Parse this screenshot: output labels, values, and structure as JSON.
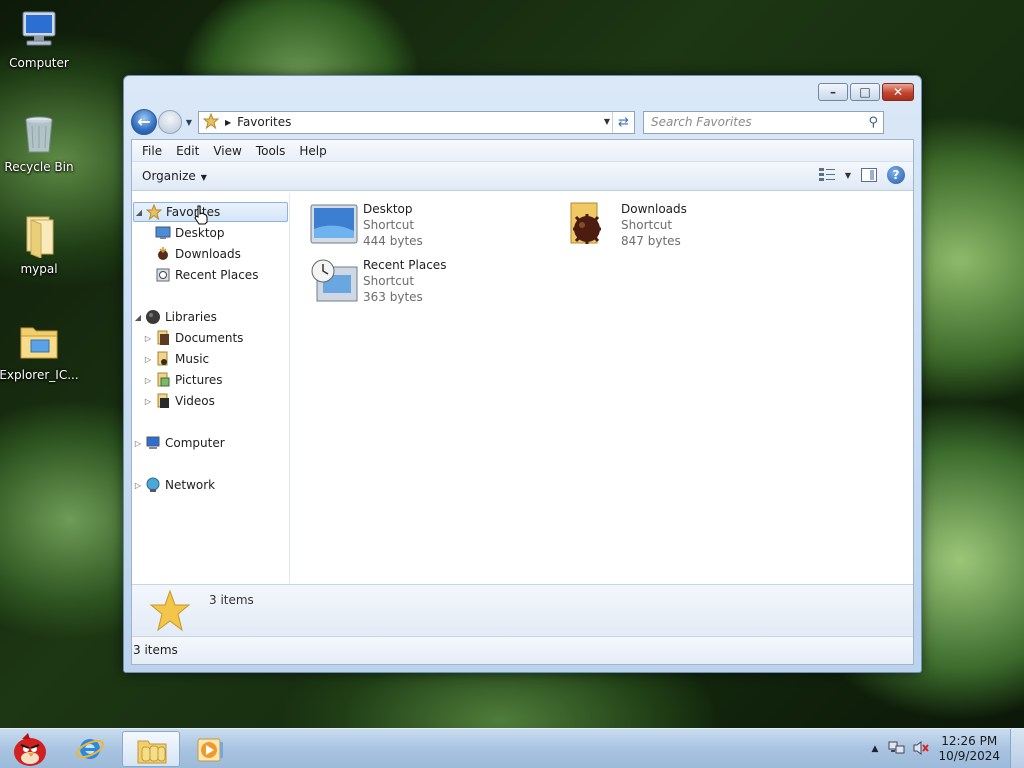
{
  "desktop": {
    "icons": [
      {
        "label": "Computer",
        "icon": "computer-icon"
      },
      {
        "label": "Recycle Bin",
        "icon": "recycle-bin-icon"
      },
      {
        "label": "mypal",
        "icon": "folder-icon"
      },
      {
        "label": "Explorer_IC...",
        "icon": "folder-icon"
      }
    ]
  },
  "window": {
    "address": {
      "crumb": "Favorites"
    },
    "search": {
      "placeholder": "Search Favorites"
    },
    "menu": [
      "File",
      "Edit",
      "View",
      "Tools",
      "Help"
    ],
    "command": {
      "organize": "Organize"
    },
    "nav_tree": [
      {
        "label": "Favorites",
        "icon": "favorites-star-icon",
        "expanded": true,
        "selected": true
      },
      {
        "label": "Desktop",
        "icon": "desktop-icon"
      },
      {
        "label": "Downloads",
        "icon": "downloads-icon"
      },
      {
        "label": "Recent Places",
        "icon": "recent-places-icon"
      },
      {
        "label": "Libraries",
        "icon": "libraries-icon",
        "expanded": true
      },
      {
        "label": "Documents",
        "icon": "documents-icon"
      },
      {
        "label": "Music",
        "icon": "music-icon"
      },
      {
        "label": "Pictures",
        "icon": "pictures-icon"
      },
      {
        "label": "Videos",
        "icon": "videos-icon"
      },
      {
        "label": "Computer",
        "icon": "computer-icon"
      },
      {
        "label": "Network",
        "icon": "network-icon"
      }
    ],
    "files": [
      {
        "name": "Desktop",
        "type": "Shortcut",
        "size": "444 bytes",
        "icon": "desktop-icon"
      },
      {
        "name": "Downloads",
        "type": "Shortcut",
        "size": "847 bytes",
        "icon": "downloads-icon"
      },
      {
        "name": "Recent Places",
        "type": "Shortcut",
        "size": "363 bytes",
        "icon": "recent-places-icon"
      }
    ],
    "details": {
      "count": "3 items"
    },
    "status": {
      "text": "3 items"
    }
  },
  "taskbar": {
    "pinned": [
      "angry-birds-icon",
      "internet-explorer-icon",
      "explorer-folder-icon",
      "media-player-icon"
    ],
    "clock": {
      "time": "12:26 PM",
      "date": "10/9/2024"
    }
  },
  "colors": {
    "accent": "#3d6fb0",
    "selection": "#d4e5f8",
    "taskbar": "#a9c4e2"
  }
}
